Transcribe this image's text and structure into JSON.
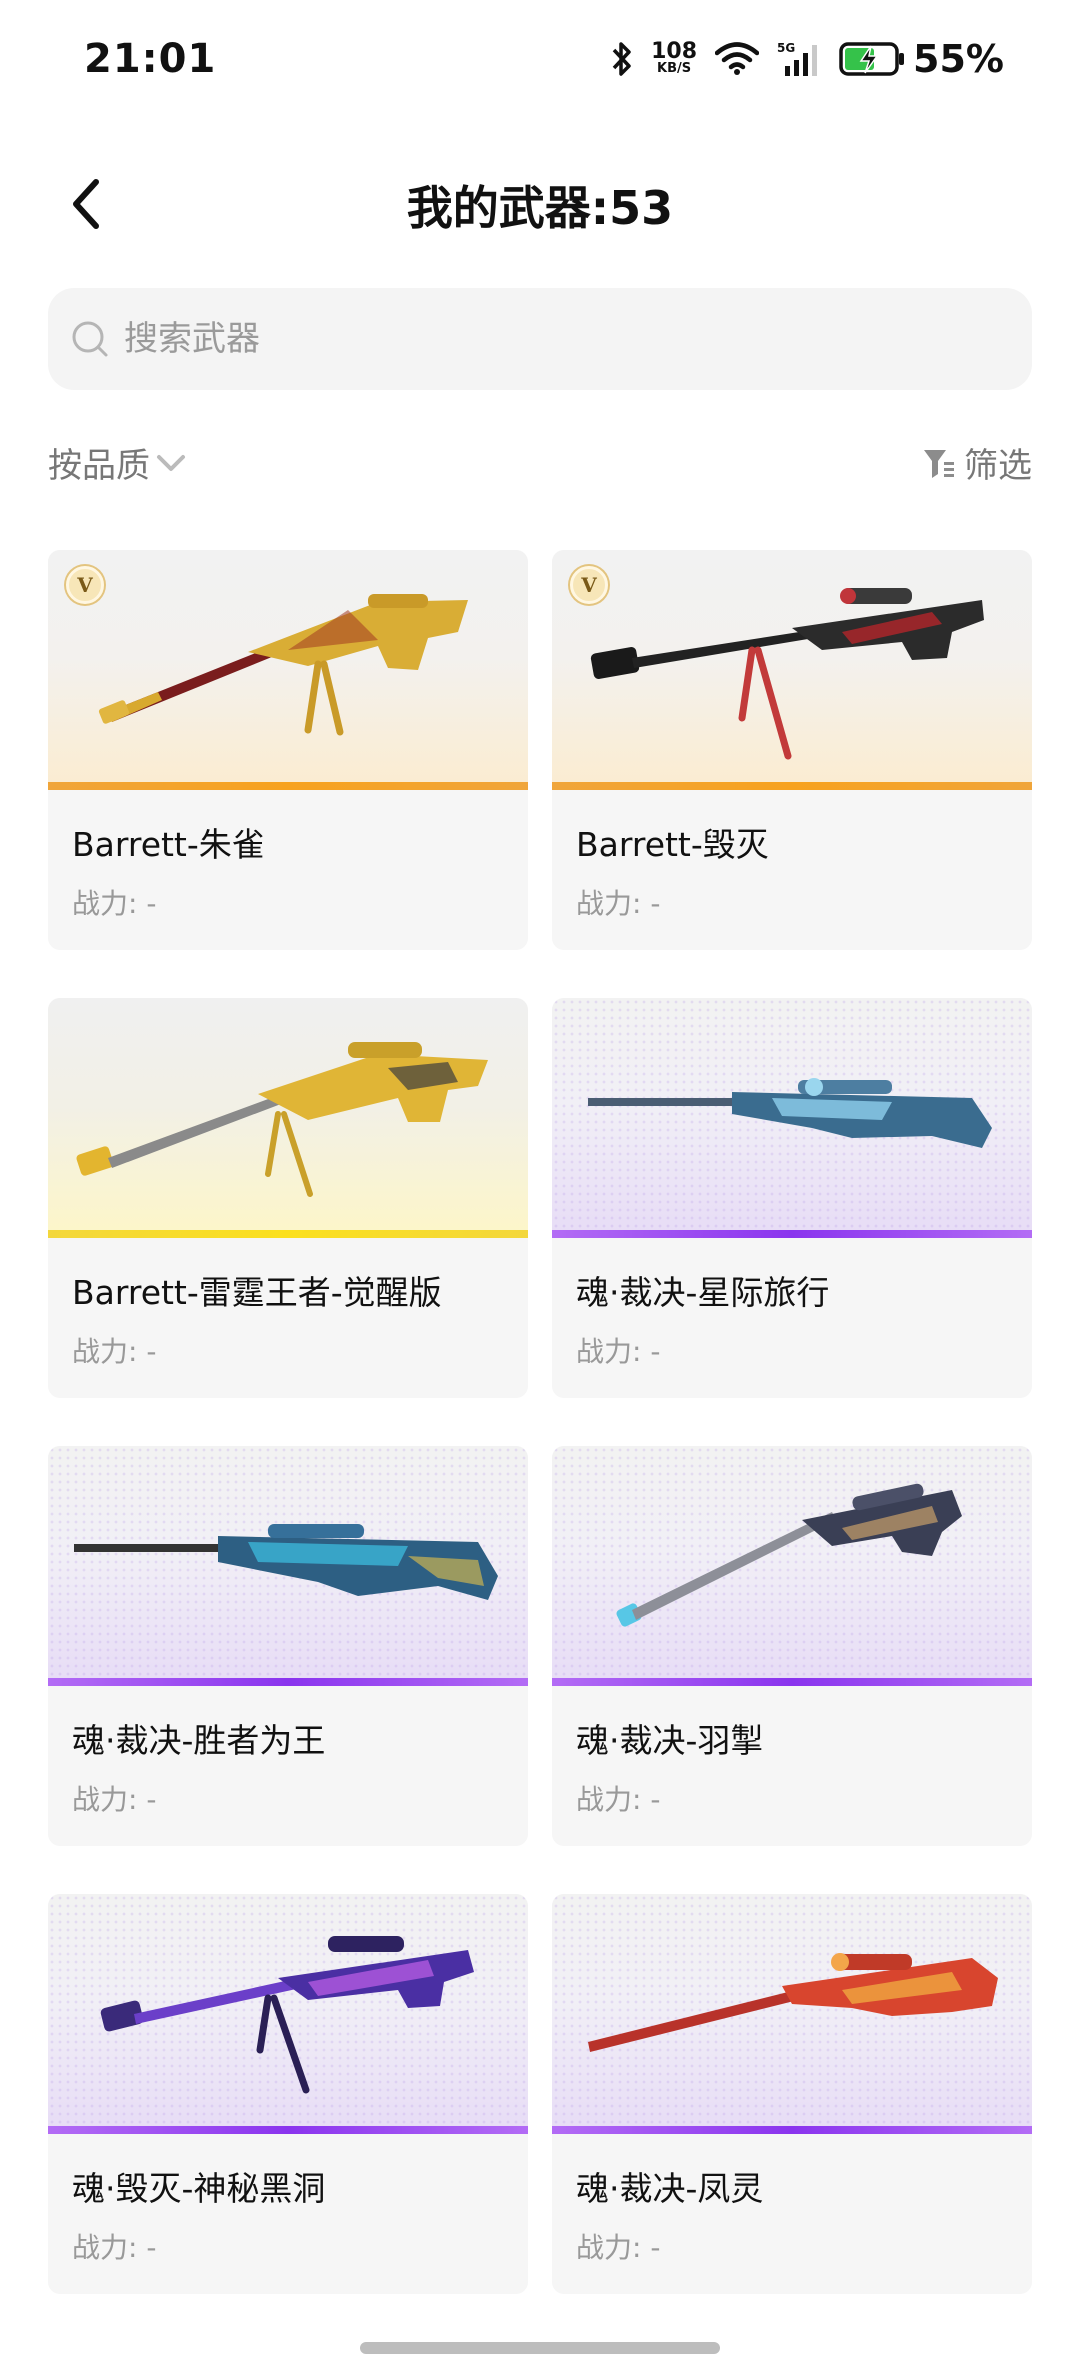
{
  "status": {
    "time": "21:01",
    "net_speed": "108",
    "net_unit": "KB/S",
    "signal": "5G",
    "battery": "55%"
  },
  "header": {
    "title": "我的武器:53",
    "back_icon": "chevron-left-icon"
  },
  "search": {
    "placeholder": "搜索武器"
  },
  "toolbar": {
    "sort_label": "按品质",
    "filter_label": "筛选"
  },
  "colors": {
    "gold_rarity": "#f7a21e",
    "yellow_rarity": "#fbe01e",
    "purple_rarity": "#8a34ee"
  },
  "weapons": [
    {
      "name": "Barrett-朱雀",
      "power": "战力: -",
      "rarity": "gold",
      "badge": "V"
    },
    {
      "name": "Barrett-毁灭",
      "power": "战力: -",
      "rarity": "gold",
      "badge": "V"
    },
    {
      "name": "Barrett-雷霆王者-觉醒版",
      "power": "战力: -",
      "rarity": "yellow"
    },
    {
      "name": "魂·裁决-星际旅行",
      "power": "战力: -",
      "rarity": "purple"
    },
    {
      "name": "魂·裁决-胜者为王",
      "power": "战力: -",
      "rarity": "purple"
    },
    {
      "name": "魂·裁决-羽掣",
      "power": "战力: -",
      "rarity": "purple"
    },
    {
      "name": "魂·毁灭-神秘黑洞",
      "power": "战力: -",
      "rarity": "purple"
    },
    {
      "name": "魂·裁决-凤灵",
      "power": "战力: -",
      "rarity": "purple"
    }
  ]
}
